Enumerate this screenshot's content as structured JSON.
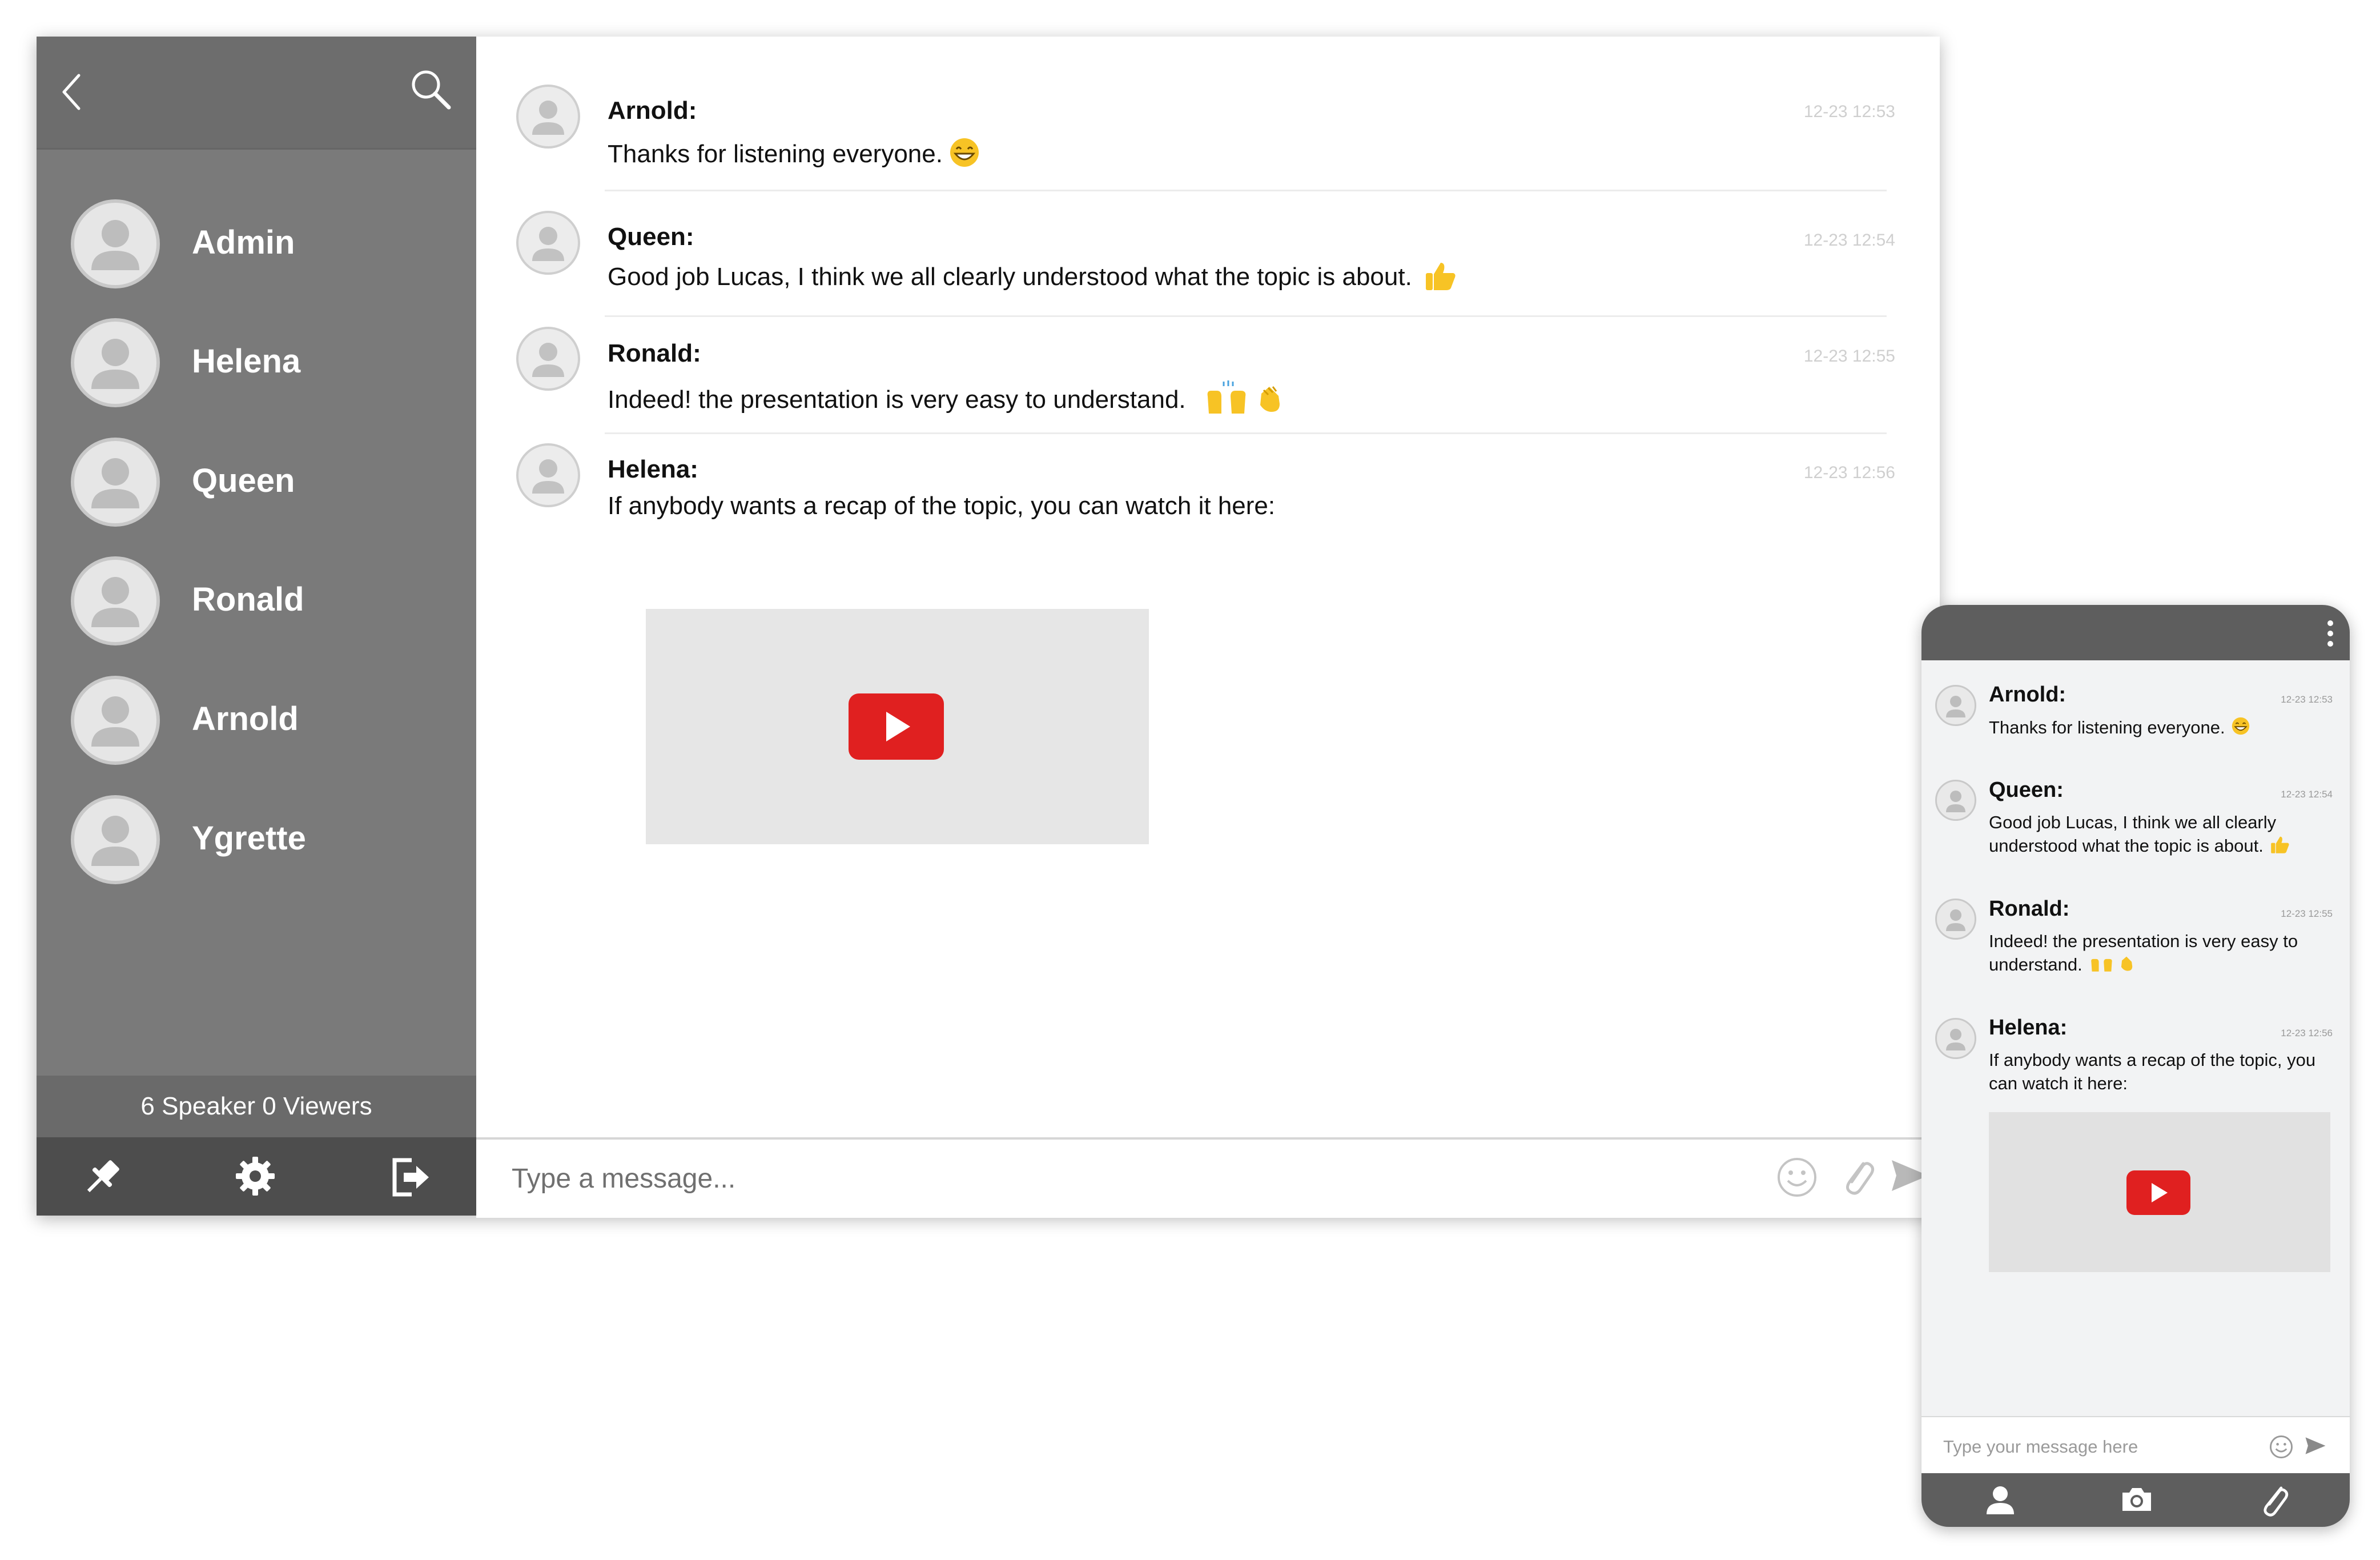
{
  "sidebar": {
    "contacts": [
      {
        "name": "Admin"
      },
      {
        "name": "Helena"
      },
      {
        "name": "Queen"
      },
      {
        "name": "Ronald"
      },
      {
        "name": "Arnold"
      },
      {
        "name": "Ygrette"
      }
    ],
    "viewers_text": "6 Speaker 0 Viewers"
  },
  "chat": {
    "messages": [
      {
        "author": "Arnold:",
        "text": "Thanks for listening everyone.",
        "time": "12-23 12:53",
        "emoji": "grinning-face"
      },
      {
        "author": "Queen:",
        "text": "Good job Lucas, I think we all clearly understood what the topic is about.",
        "time": "12-23 12:54",
        "emoji": "thumbs-up"
      },
      {
        "author": "Ronald:",
        "text": "Indeed! the presentation is very easy to understand.",
        "time": "12-23 12:55",
        "emoji": "raising-hands, waving-hand"
      },
      {
        "author": "Helena:",
        "text": "If anybody wants a recap of the topic, you can watch it here:",
        "time": "12-23 12:56",
        "attachment": "video"
      }
    ],
    "composer_placeholder": "Type a message..."
  },
  "mobile": {
    "messages": [
      {
        "author": "Arnold:",
        "text": "Thanks for listening everyone.",
        "time": "12-23 12:53"
      },
      {
        "author": "Queen:",
        "text": "Good job Lucas, I think we all clearly understood what the topic is about.",
        "time": "12-23 12:54"
      },
      {
        "author": "Ronald:",
        "text": "Indeed! the presentation is very easy to understand.",
        "time": "12-23 12:55"
      },
      {
        "author": "Helena:",
        "text": "If anybody wants a recap of the topic, you can watch it here:",
        "time": "12-23 12:56"
      }
    ],
    "composer_placeholder": "Type your message here"
  },
  "colors": {
    "sidebar_bg": "#7a7a7a",
    "sidebar_bottom_bg": "#4d4d4d",
    "play_button": "#e02020",
    "timestamp": "#cfcfcf"
  },
  "icons": [
    "back-icon",
    "search-icon",
    "pin-icon",
    "gear-icon",
    "logout-icon",
    "emoji-icon",
    "paperclip-icon",
    "send-icon",
    "more-vertical-icon",
    "user-icon",
    "camera-icon"
  ]
}
